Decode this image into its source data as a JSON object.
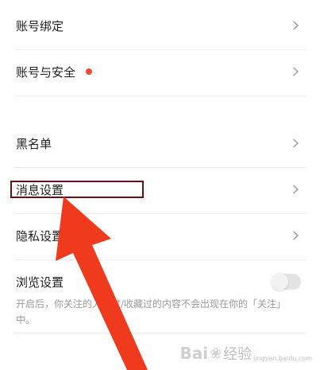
{
  "settings": {
    "items": [
      {
        "label": "账号绑定"
      },
      {
        "label": "账号与安全"
      },
      {
        "label": "黑名单"
      },
      {
        "label": "消息设置"
      },
      {
        "label": "隐私设置"
      }
    ],
    "browse": {
      "label": "浏览设置",
      "toggle_on": false,
      "description": "开启后，你关注的人赞过/收藏过的内容不会出现在你的「关注」中。"
    }
  },
  "watermark": {
    "brand": "Bai",
    "suffix": "经验",
    "sub": "jingyan.baidu.com"
  },
  "colors": {
    "badge": "#f04a3b",
    "arrow": "#f03a1e",
    "highlight_border": "#6a0f16",
    "divider": "#ececec"
  }
}
